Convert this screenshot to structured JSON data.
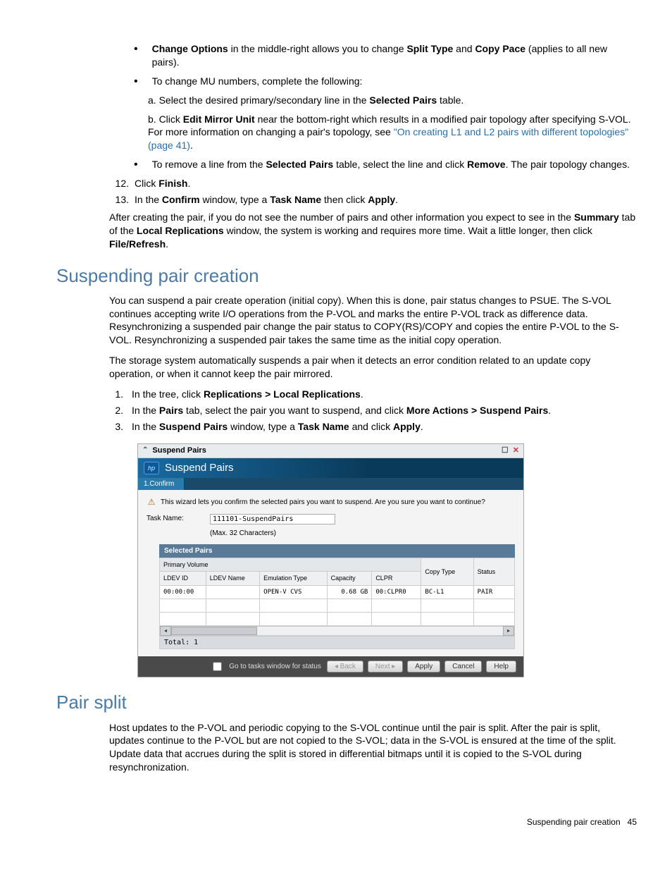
{
  "bullets": {
    "b1_pre": "Change Options",
    "b1_mid": " in the middle-right allows you to change ",
    "b1_st": "Split Type",
    "b1_and": " and ",
    "b1_cp": "Copy Pace",
    "b1_post": " (applies to all new pairs).",
    "b2": "To change MU numbers, complete the following:",
    "b2a_pre": "a. Select the desired primary/secondary line in the ",
    "b2a_sp": "Selected Pairs",
    "b2a_post": " table.",
    "b2b_pre": "b. Click ",
    "b2b_emu": "Edit Mirror Unit",
    "b2b_mid": " near the bottom-right which results in a modified pair topology after specifying S-VOL. For more information on changing a pair's topology, see ",
    "b2b_link": "\"On creating L1 and L2 pairs with different topologies\" (page 41)",
    "b2b_post": ".",
    "b3_pre": "To remove a line from the ",
    "b3_sp": "Selected Pairs",
    "b3_mid": " table, select the line and click ",
    "b3_rm": "Remove",
    "b3_post": ". The pair topology changes."
  },
  "steps12_pre": "Click ",
  "steps12_b": "Finish",
  "steps12_post": ".",
  "steps13_pre": "In the ",
  "steps13_c": "Confirm",
  "steps13_mid": " window, type a ",
  "steps13_tn": "Task Name",
  "steps13_mid2": " then click ",
  "steps13_ap": "Apply",
  "steps13_post": ".",
  "after_pre": "After creating the pair, if you do not see the number of pairs and other information you expect to see in the ",
  "after_sum": "Summary",
  "after_mid": " tab of the ",
  "after_lr": "Local Replications",
  "after_mid2": " window, the system is working and requires more time. Wait a little longer, then click ",
  "after_fr": "File/Refresh",
  "after_post": ".",
  "h_suspend": "Suspending pair creation",
  "suspend_p1": "You can suspend a pair create operation (initial copy). When this is done, pair status changes to PSUE. The S-VOL continues accepting write I/O operations from the P-VOL and marks the entire P-VOL track as difference data. Resynchronizing a suspended pair change the pair status to COPY(RS)/COPY and copies the entire P-VOL to the S-VOL. Resynchronizing a suspended pair takes the same time as the initial copy operation.",
  "suspend_p2": "The storage system automatically suspends a pair when it detects an error condition related to an update copy operation, or when it cannot keep the pair mirrored.",
  "s1_pre": "In the tree, click ",
  "s1_b": "Replications > Local Replications",
  "s1_post": ".",
  "s2_pre": "In the ",
  "s2_p": "Pairs",
  "s2_mid": " tab, select the pair you want to suspend, and click ",
  "s2_ma": "More Actions > Suspend Pairs",
  "s2_post": ".",
  "s3_pre": "In the ",
  "s3_sp": "Suspend Pairs",
  "s3_mid": " window, type a ",
  "s3_tn": "Task Name",
  "s3_mid2": " and click ",
  "s3_ap": "Apply",
  "s3_post": ".",
  "dialog": {
    "titlebar": "Suspend Pairs",
    "header": "Suspend Pairs",
    "step": "1.Confirm",
    "wizard_text": "This wizard lets you confirm the selected pairs you want to suspend. Are you sure you want to continue?",
    "task_label": "Task Name:",
    "task_value": "111101-SuspendPairs",
    "max_chars": "(Max. 32 Characters)",
    "table_title": "Selected Pairs",
    "group_header": "Primary Volume",
    "cols": {
      "ldevid": "LDEV ID",
      "ldevname": "LDEV Name",
      "emul": "Emulation Type",
      "cap": "Capacity",
      "clpr": "CLPR",
      "copytype": "Copy Type",
      "status": "Status"
    },
    "row": {
      "ldevid": "00:00:00",
      "ldevname": "",
      "emul": "OPEN-V CVS",
      "cap": "0.68 GB",
      "clpr": "00:CLPR0",
      "copytype": "BC-L1",
      "status": "PAIR"
    },
    "total": "Total: 1",
    "goto": "Go to tasks window for status",
    "back": "◂ Back",
    "next": "Next ▸",
    "apply": "Apply",
    "cancel": "Cancel",
    "help": "Help"
  },
  "h_split": "Pair split",
  "split_p": "Host updates to the P-VOL and periodic copying to the S-VOL continue until the pair is split. After the pair is split, updates continue to the P-VOL but are not copied to the S-VOL; data in the S-VOL is ensured at the time of the split. Update data that accrues during the split is stored in differential bitmaps until it is copied to the S-VOL during resynchronization.",
  "footer_text": "Suspending pair creation",
  "footer_page": "45"
}
